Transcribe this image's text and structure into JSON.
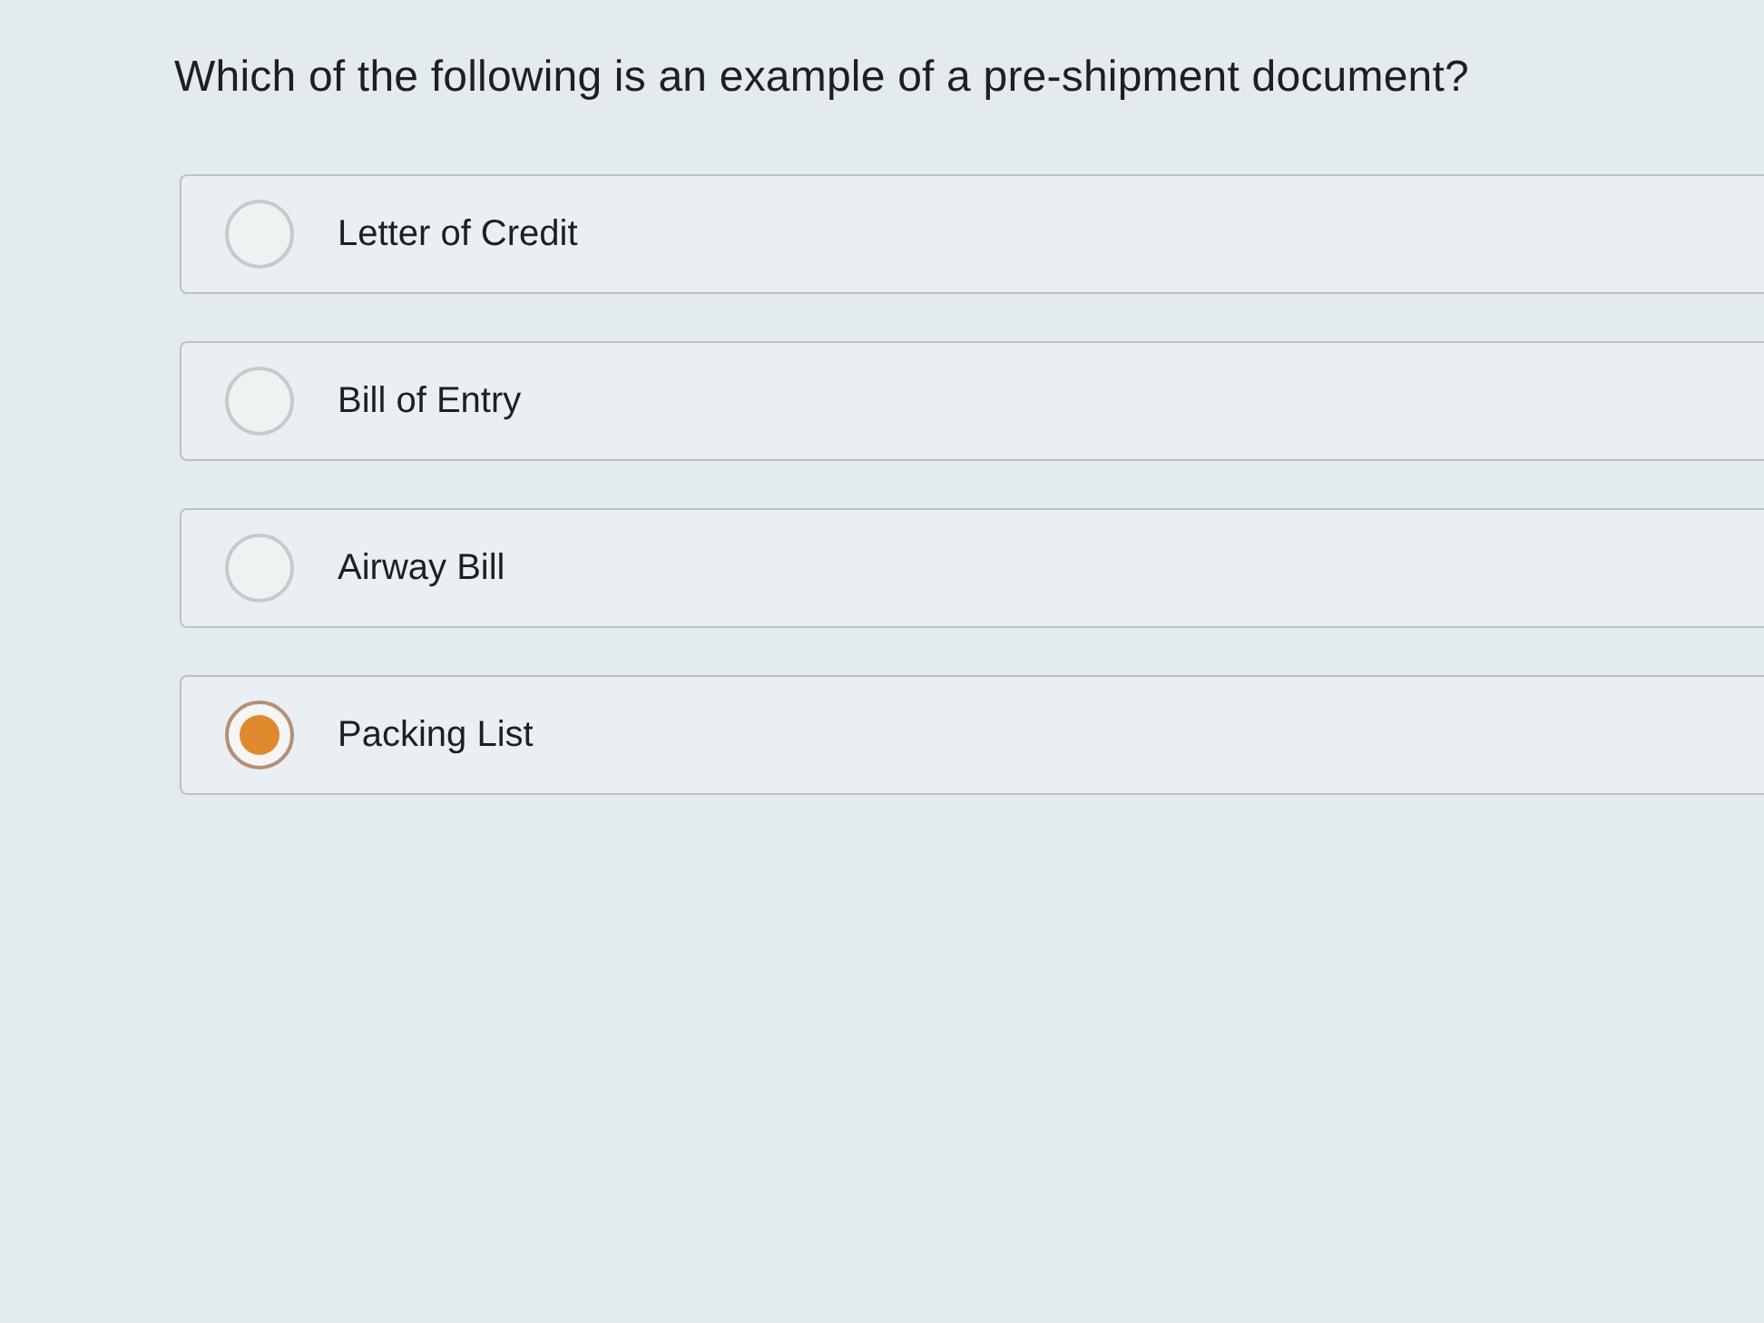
{
  "question": {
    "text": "Which of the following is an example of a pre-shipment document?"
  },
  "options": [
    {
      "label": "Letter of Credit",
      "selected": false
    },
    {
      "label": "Bill of Entry",
      "selected": false
    },
    {
      "label": "Airway Bill",
      "selected": false
    },
    {
      "label": "Packing List",
      "selected": true
    }
  ]
}
